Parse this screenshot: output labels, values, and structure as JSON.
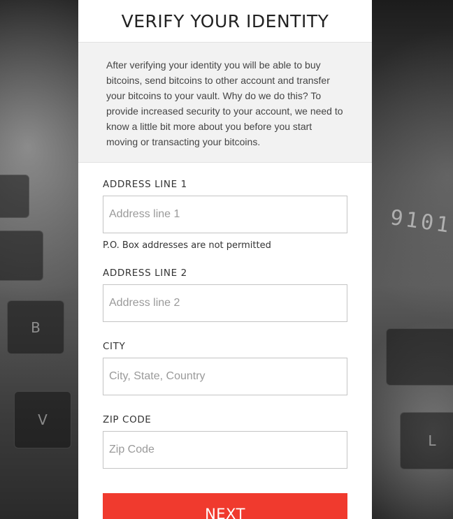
{
  "header": {
    "title": "VERIFY YOUR IDENTITY"
  },
  "intro": {
    "text": "After verifying your identity you will be able to buy bitcoins, send bitcoins to other account and transfer your bitcoins to your vault. Why do we do this? To provide increased security to your account, we need to know a little bit more about you before you start moving or transacting your bitcoins."
  },
  "form": {
    "address1": {
      "label": "ADDRESS LINE 1",
      "placeholder": "Address line 1",
      "value": "",
      "hint": "P.O. Box addresses are not permitted"
    },
    "address2": {
      "label": "ADDRESS LINE 2",
      "placeholder": "Address line 2",
      "value": ""
    },
    "city": {
      "label": "CITY",
      "placeholder": "City, State, Country",
      "value": ""
    },
    "zip": {
      "label": "ZIP CODE",
      "placeholder": "Zip Code",
      "value": ""
    },
    "next_label": "NEXT"
  },
  "background": {
    "card_number": "9101",
    "keys": [
      "B",
      "V",
      "L"
    ]
  },
  "colors": {
    "accent": "#f03a2e",
    "panel": "#ffffff",
    "intro_bg": "#f2f2f2",
    "input_border": "#c4c4c4"
  }
}
